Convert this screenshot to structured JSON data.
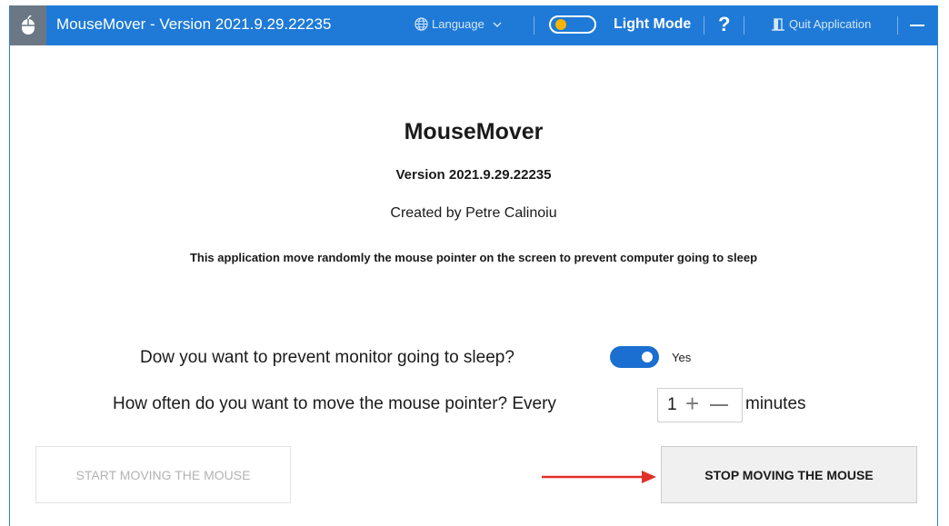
{
  "titlebar": {
    "title": "MouseMover - Version 2021.9.29.22235",
    "language_label": "Language",
    "mode_label": "Light Mode",
    "help_label": "?",
    "quit_label": "Quit Application"
  },
  "about": {
    "app_name": "MouseMover",
    "version": "Version 2021.9.29.22235",
    "author": "Created by Petre Calinoiu",
    "description": "This application move randomly the mouse pointer on the screen to prevent computer going to sleep"
  },
  "settings": {
    "sleep_question": "Dow you want to prevent monitor going to sleep?",
    "sleep_toggle_state": "Yes",
    "sleep_toggle_on": true,
    "interval_question": "How often do you want to move the mouse pointer? Every",
    "interval_value": "1",
    "interval_unit": "minutes"
  },
  "actions": {
    "start_label": "START MOVING THE MOUSE",
    "start_enabled": false,
    "stop_label": "STOP MOVING THE MOUSE",
    "stop_enabled": true
  },
  "icons": [
    "mouse-icon",
    "globe-icon",
    "chevron-down-icon",
    "help-icon",
    "door-exit-icon",
    "minimize-icon",
    "arrow-annotation"
  ],
  "colors": {
    "titlebar": "#1e7ad6",
    "toggle_on": "#1a6fd1",
    "mode_knob": "#f5b400",
    "annotation_arrow": "#e0302a"
  }
}
